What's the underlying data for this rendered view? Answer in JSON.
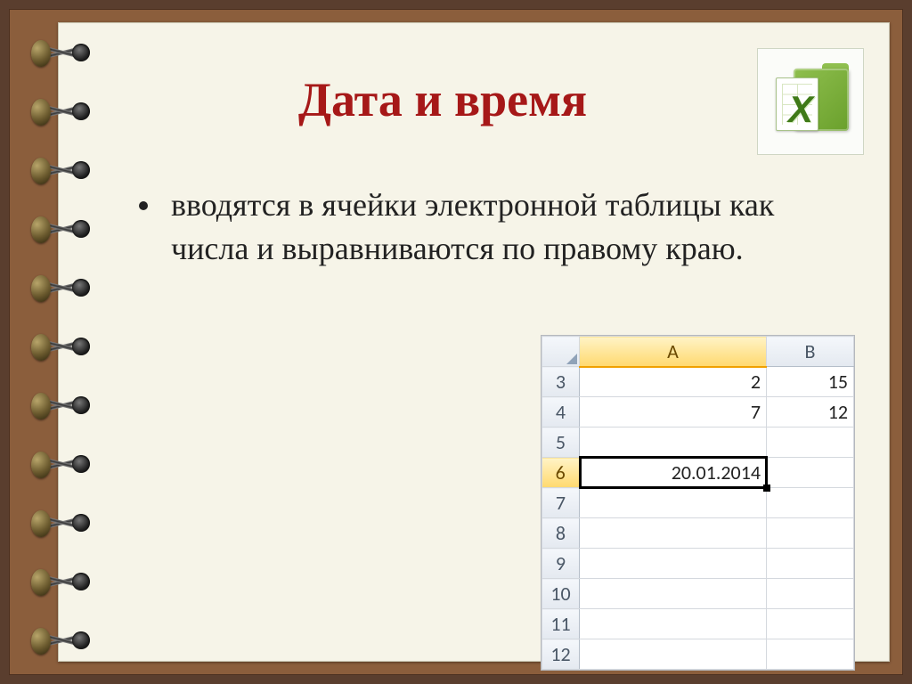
{
  "slide": {
    "title": "Дата и время",
    "bullet_text": "вводятся в ячейки электронной таблицы как числа и выравниваются по правому краю."
  },
  "excel": {
    "columns": [
      "A",
      "B"
    ],
    "visible_row_start": 3,
    "visible_row_end": 12,
    "selected_cell": "A6",
    "cells": {
      "A3": "2",
      "B3": "15",
      "A4": "7",
      "B4": "12",
      "A6": "20.01.2014"
    }
  },
  "icons": {
    "excel_x": "X"
  }
}
